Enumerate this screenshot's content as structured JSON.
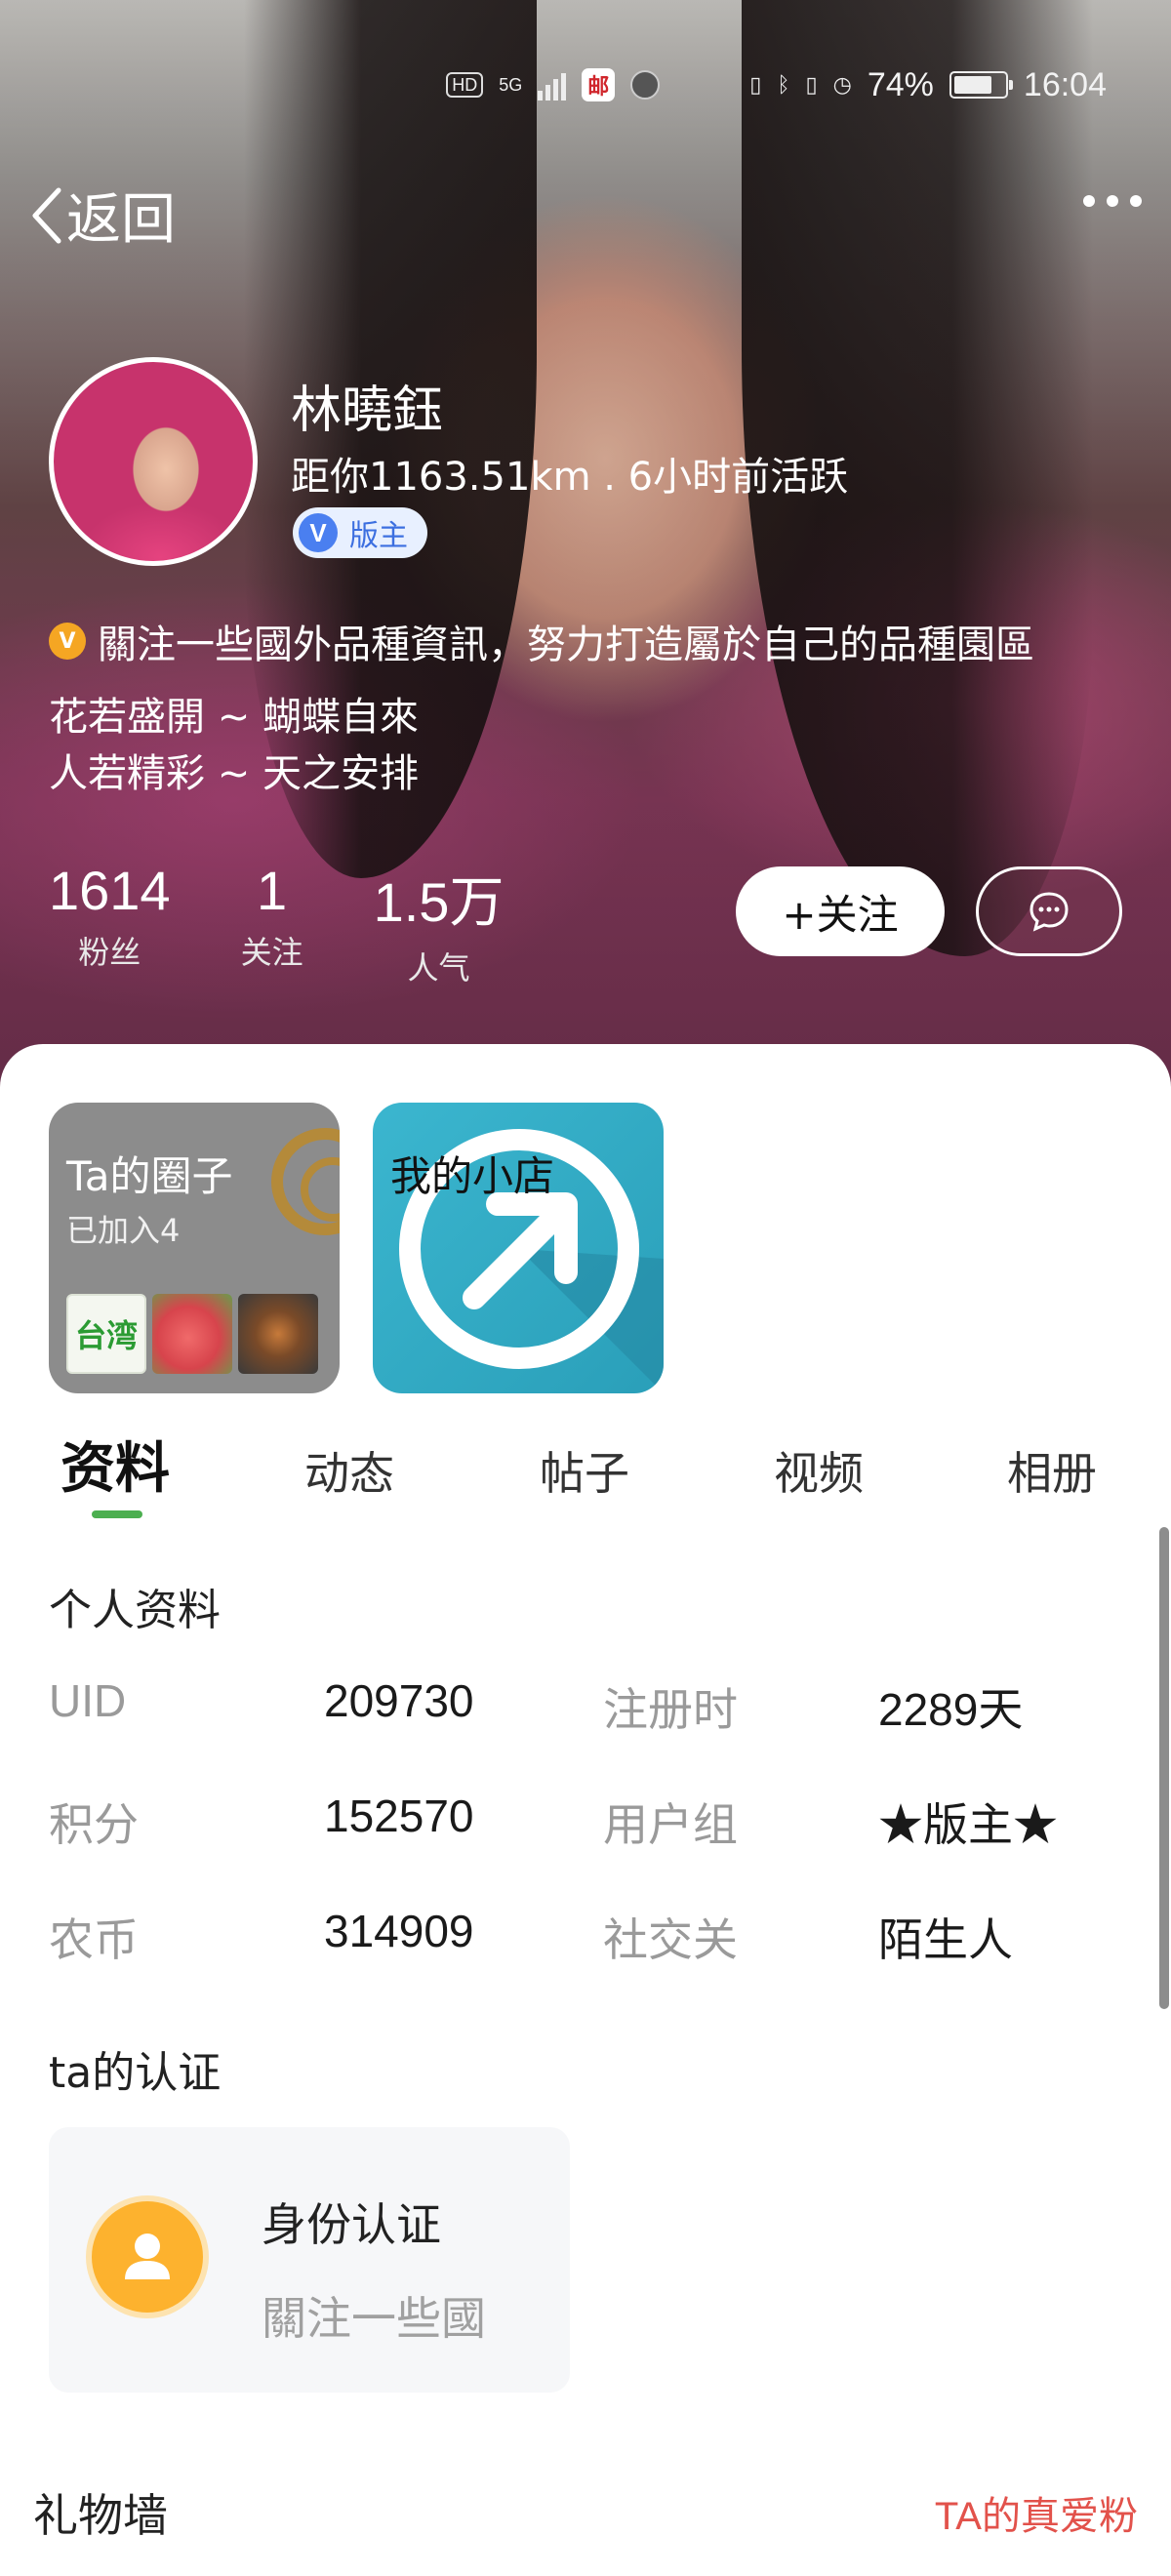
{
  "status_bar": {
    "network_hd": "HD",
    "network_gen": "5G",
    "app_badge": "邮",
    "battery": "74%",
    "battery_level": 0.74,
    "time": "16:04"
  },
  "nav": {
    "back_label": "返回"
  },
  "profile": {
    "name": "林曉鈺",
    "distance_activity": "距你1163.51km . 6小时前活跃",
    "badge_letter": "V",
    "badge_label": "版主",
    "motto_icon": "V",
    "motto": "關注一些國外品種資訊，努力打造屬於自己的品種園區",
    "bio_line1": "花若盛開 ~ 蝴蝶自來",
    "bio_line2": "人若精彩 ~ 天之安排"
  },
  "stats": [
    {
      "value": "1614",
      "label": "粉丝"
    },
    {
      "value": "1",
      "label": "关注"
    },
    {
      "value": "1.5万",
      "label": "人气"
    }
  ],
  "actions": {
    "follow_label": "+关注"
  },
  "cards": {
    "circle_title": "Ta的圈子",
    "circle_sub": "已加入4",
    "circle_thumb_label": "台湾",
    "shop_title": "我的小店"
  },
  "tabs": [
    "资料",
    "动态",
    "帖子",
    "视频",
    "相册"
  ],
  "info": {
    "section_title": "个人资料",
    "rows": [
      {
        "label1": "UID",
        "value1": "209730",
        "label2": "注册时",
        "value2": "2289天"
      },
      {
        "label1": "积分",
        "value1": "152570",
        "label2": "用户组",
        "value2": "★版主★"
      },
      {
        "label1": "农币",
        "value1": "314909",
        "label2": "社交关",
        "value2": "陌生人"
      }
    ]
  },
  "certification": {
    "section_title": "ta的认证",
    "title": "身份认证",
    "subtitle": "關注一些國"
  },
  "gifts": {
    "title": "礼物墙",
    "fans_link": "TA的真爱粉"
  },
  "colors": {
    "accent_green": "#4caf50",
    "badge_blue": "#4a7ff0",
    "motto_orange": "#f5a623",
    "fans_red": "#e2524b",
    "cert_yellow": "#fdb22e",
    "shop_teal": "#3bb6cf"
  }
}
